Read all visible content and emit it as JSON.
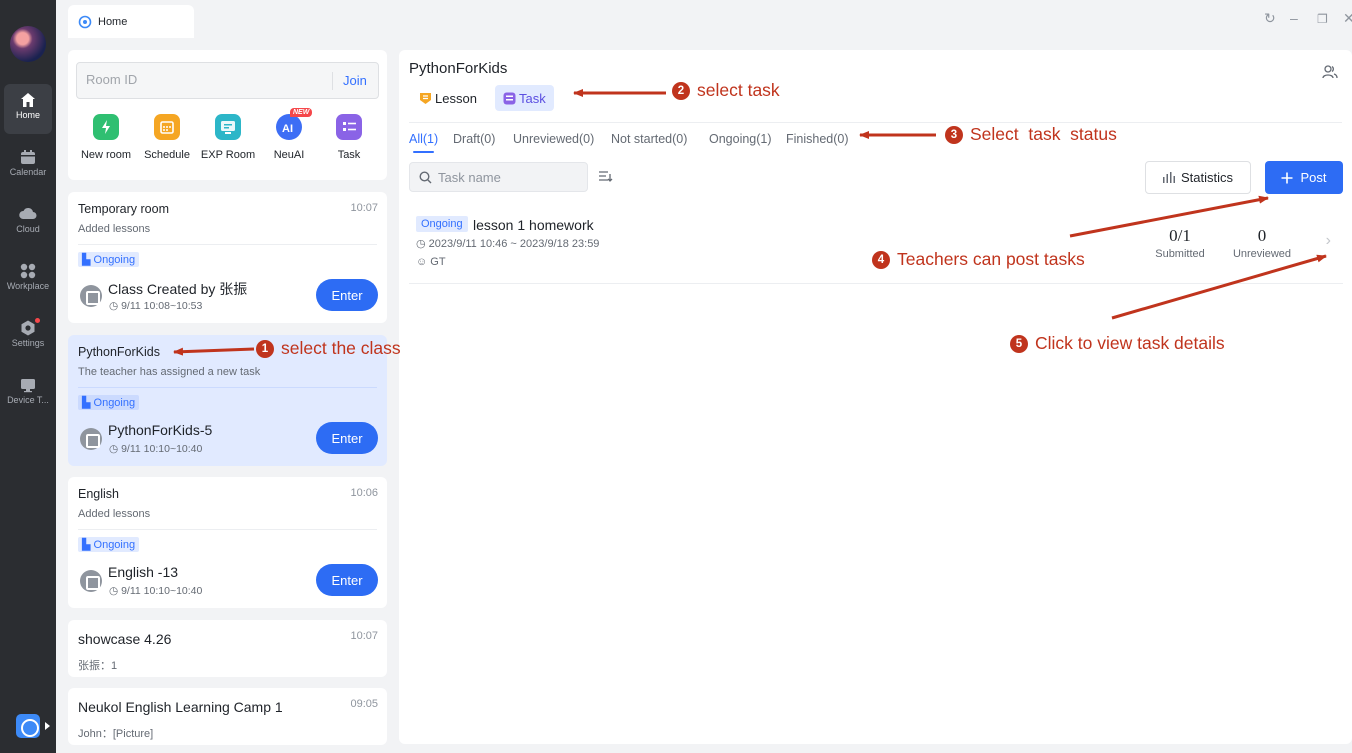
{
  "window": {
    "tab_label": "Home",
    "controls": [
      "refresh-icon",
      "minimize-icon",
      "restore-icon",
      "close-icon"
    ]
  },
  "rail": {
    "items": [
      {
        "label": "Home",
        "icon": "home-icon"
      },
      {
        "label": "Calendar",
        "icon": "calendar-icon"
      },
      {
        "label": "Cloud",
        "icon": "cloud-icon"
      },
      {
        "label": "Workplace",
        "icon": "workplace-icon"
      },
      {
        "label": "Settings",
        "icon": "settings-icon"
      },
      {
        "label": "Device T...",
        "icon": "device-icon"
      }
    ]
  },
  "join": {
    "placeholder": "Room ID",
    "button": "Join"
  },
  "quick_actions": [
    {
      "label": "New room",
      "icon": "new-room-icon",
      "color": "#2fbf71"
    },
    {
      "label": "Schedule",
      "icon": "schedule-icon",
      "color": "#f5a623"
    },
    {
      "label": "EXP Room",
      "icon": "exp-room-icon",
      "color": "#2cb6c8"
    },
    {
      "label": "NeuAI",
      "icon": "neuai-icon",
      "color": "#3d6ef5",
      "badge": "NEW"
    },
    {
      "label": "Task",
      "icon": "task-icon",
      "color": "#8a63e6"
    }
  ],
  "class_cards": [
    {
      "title": "Temporary room",
      "time": "10:07",
      "subtitle": "Added lessons",
      "status": "Ongoing",
      "class_name": "Class Created by 张振",
      "class_time": "9/11 10:08~10:53",
      "button": "Enter"
    },
    {
      "title": "PythonForKids",
      "time": "",
      "subtitle": "The teacher has assigned a new task",
      "status": "Ongoing",
      "class_name": "PythonForKids-5",
      "class_time": "9/11 10:10~10:40",
      "button": "Enter"
    },
    {
      "title": "English",
      "time": "10:06",
      "subtitle": "Added lessons",
      "status": "Ongoing",
      "class_name": "English -13",
      "class_time": "9/11 10:10~10:40",
      "button": "Enter"
    }
  ],
  "simple_cards": [
    {
      "title": "showcase 4.26",
      "time": "10:07",
      "subtitle": "张振：1"
    },
    {
      "title": "Neukol English Learning Camp 1",
      "time": "09:05",
      "subtitle": "John：[Picture]"
    }
  ],
  "main": {
    "title": "PythonForKids",
    "segments": [
      "Lesson",
      "Task"
    ],
    "status_tabs": [
      "All(1)",
      "Draft(0)",
      "Unreviewed(0)",
      "Not started(0)",
      "Ongoing(1)",
      "Finished(0)"
    ],
    "search_placeholder": "Task name",
    "statistics_button": "Statistics",
    "post_button": "Post",
    "task": {
      "status": "Ongoing",
      "name": "lesson 1 homework",
      "date_range": "2023/9/11 10:46 ~ 2023/9/18 23:59",
      "author": "GT",
      "submitted_value": "0/1",
      "submitted_label": "Submitted",
      "unreviewed_value": "0",
      "unreviewed_label": "Unreviewed"
    }
  },
  "annotations": [
    {
      "num": "1",
      "text": "select the class"
    },
    {
      "num": "2",
      "text": "select task"
    },
    {
      "num": "3",
      "text": "Select  task  status"
    },
    {
      "num": "4",
      "text": "Teachers can post tasks"
    },
    {
      "num": "5",
      "text": "Click to view task details"
    }
  ],
  "colors": {
    "accent": "#2d6cf4",
    "annotation": "#c0341d",
    "rail": "#2b2d31",
    "selected_card": "#e1eaff"
  }
}
